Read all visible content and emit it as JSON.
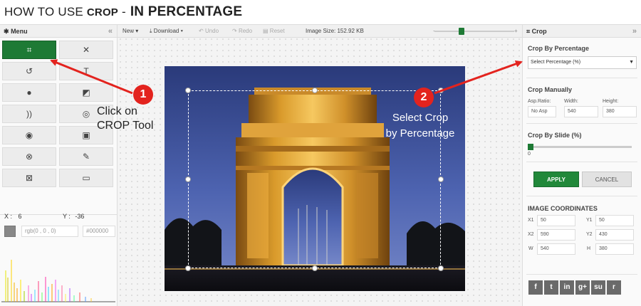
{
  "heading": {
    "prefix": "HOW TO USE ",
    "tool": "CROP",
    "dash": " -",
    "emph": "IN PERCENTAGE"
  },
  "left_panel": {
    "title": "Menu",
    "tools": [
      "crop-icon",
      "resize-icon",
      "rotate-icon",
      "text-icon",
      "drop-icon",
      "filter-icon",
      "sound-icon",
      "clock-icon",
      "eye-icon",
      "image-icon",
      "shapes-icon",
      "brush-icon",
      "frame-icon",
      "rectangle-icon"
    ],
    "x_label": "X :",
    "x_value": "6",
    "y_label": "Y :",
    "y_value": "-36",
    "rgb_text": "rgb(0 , 0 , 0)",
    "hex_text": "#000000"
  },
  "toolbar": {
    "new_label": "New",
    "download_label": "Download",
    "undo_label": "Undo",
    "redo_label": "Redo",
    "reset_label": "Reset",
    "image_size": "Image Size: 152.92 KB",
    "zoom_fraction": 0.3
  },
  "right_panel": {
    "title": "Crop",
    "crop_by_percentage_title": "Crop By Percentage",
    "select_value": "Select Percentage (%)",
    "crop_manually_title": "Crop Manually",
    "asp_ratio_label": "Asp.Ratio:",
    "asp_ratio_value": "No Asp",
    "width_label": "Width:",
    "width_value": "540",
    "height_label": "Height:",
    "height_value": "380",
    "crop_slide_title": "Crop By Slide (%)",
    "slide_value": "0",
    "apply_label": "APPLY",
    "cancel_label": "CANCEL",
    "coords_title": "IMAGE COORDINATES",
    "x1_label": "X1",
    "x1_value": "50",
    "y1_label": "Y1",
    "y1_value": "50",
    "x2_label": "X2",
    "x2_value": "590",
    "y2_label": "Y2",
    "y2_value": "430",
    "w_label": "W",
    "w_value": "540",
    "h_label": "H",
    "h_value": "380",
    "social": [
      "f",
      "t",
      "in",
      "g+",
      "su",
      "r"
    ]
  },
  "annotations": {
    "one_num": "1",
    "one_text_line1": "Click on",
    "one_text_line2": "CROP Tool",
    "two_num": "2",
    "two_text_line1": "Select Crop",
    "two_text_line2": "by Percentage",
    "arrow_color": "#e3231e",
    "accent_green": "#1e7a35"
  }
}
